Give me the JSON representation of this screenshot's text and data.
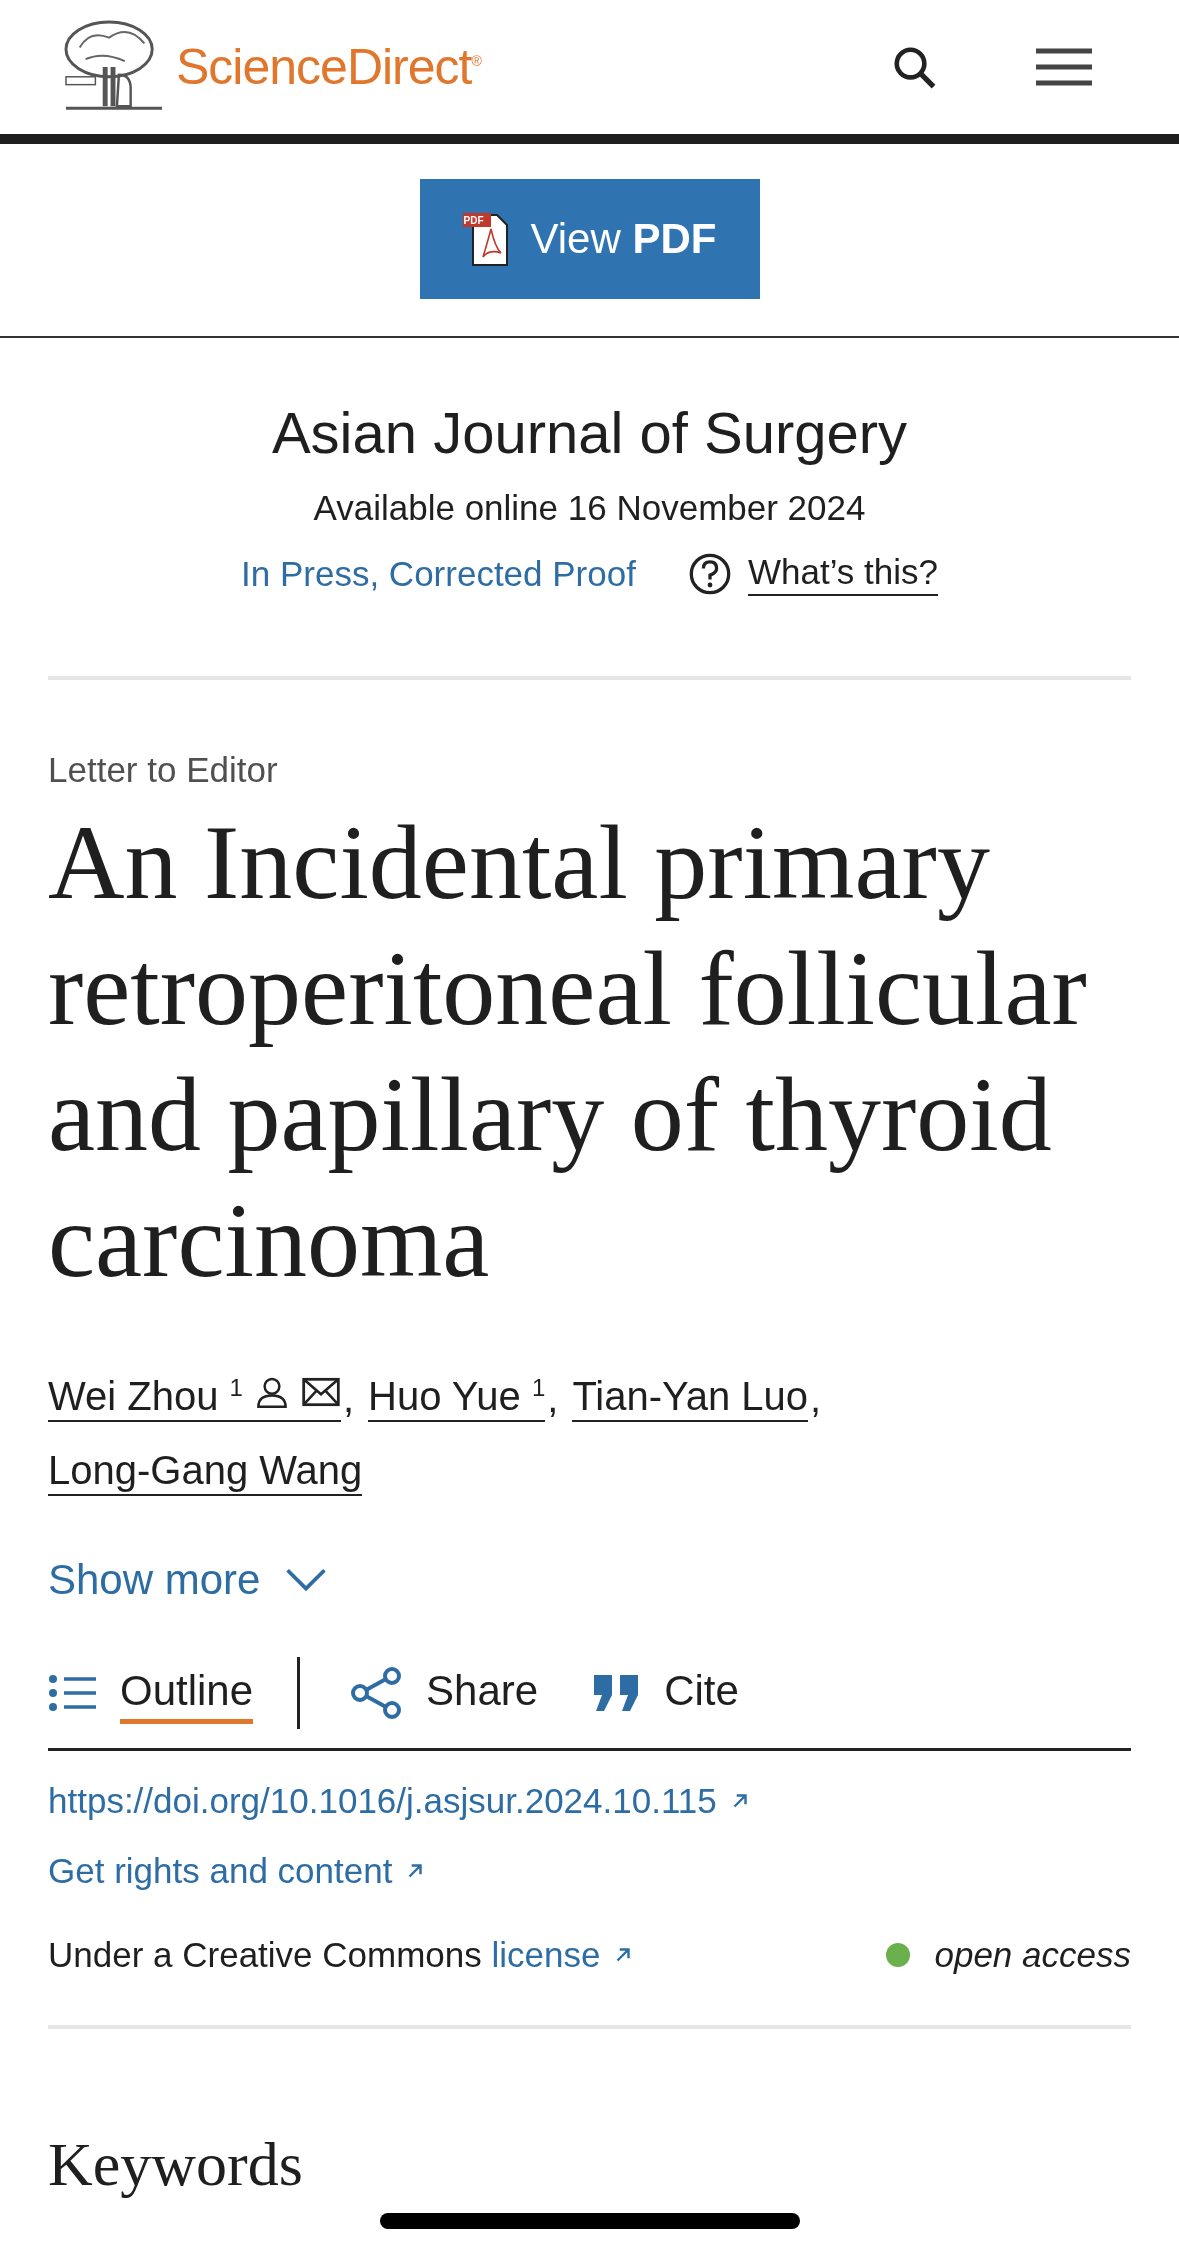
{
  "header": {
    "brand": "ScienceDirect",
    "brand_mark": "®"
  },
  "pdf_button": {
    "label": "View ",
    "label_bold": "PDF",
    "badge": "PDF"
  },
  "journal": {
    "title": "Asian Journal of Surgery",
    "available": "Available online 16 November 2024",
    "status": "In Press, Corrected Proof",
    "help": "What’s this?"
  },
  "article": {
    "type": "Letter to Editor",
    "title": "An Incidental primary retroperitoneal follicular and papillary of thyroid carcinoma",
    "authors": [
      {
        "name": "Wei Zhou",
        "note": "1",
        "corresponding": true,
        "separator": ","
      },
      {
        "name": "Huo Yue",
        "note": "1",
        "corresponding": false,
        "separator": ","
      },
      {
        "name": "Tian-Yan Luo",
        "corresponding": false,
        "separator": ","
      },
      {
        "name": "Long-Gang Wang",
        "corresponding": false
      }
    ],
    "show_more": "Show more"
  },
  "actions": [
    {
      "kind": "outline",
      "label": "Outline",
      "selected": true
    },
    {
      "kind": "share",
      "label": "Share",
      "selected": false
    },
    {
      "kind": "cite",
      "label": "Cite",
      "selected": false
    }
  ],
  "links": {
    "doi": "https://doi.org/10.1016/j.asjsur.2024.10.115",
    "rights": "Get rights and content",
    "license_prefix": "Under a Creative Commons ",
    "license": "license",
    "access": {
      "label": "open access",
      "color": "#6ab04c"
    }
  },
  "next_heading": "Keywords"
}
